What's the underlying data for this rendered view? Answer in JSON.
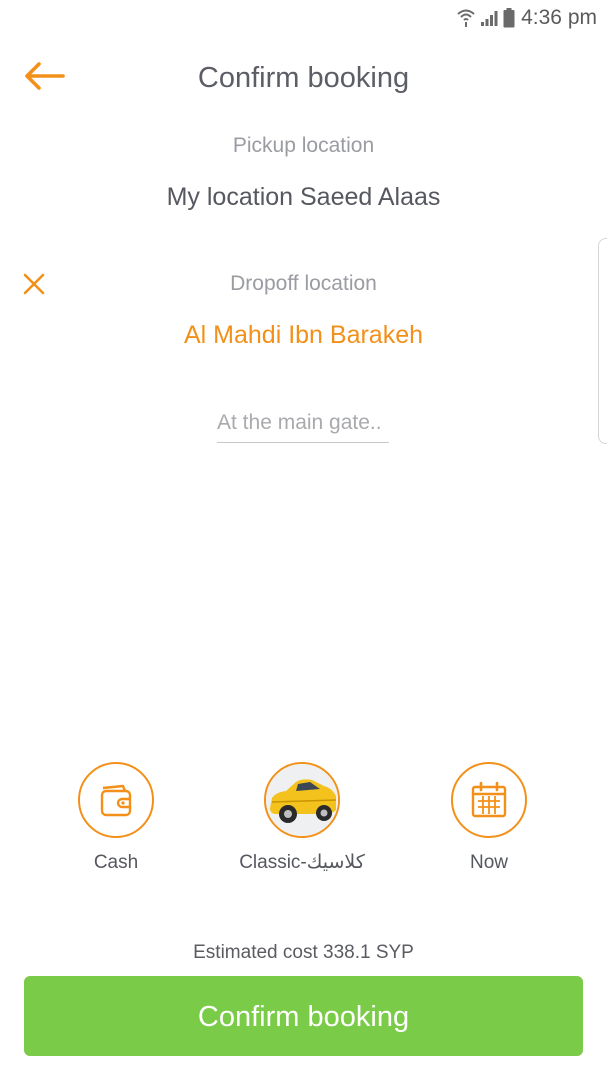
{
  "status_bar": {
    "time": "4:36 pm",
    "icons": [
      "wifi-icon",
      "signal-icon",
      "battery-icon"
    ]
  },
  "header": {
    "back_icon": "arrow-left-icon",
    "title": "Confirm booking"
  },
  "pickup": {
    "caption": "Pickup location",
    "value": "My location Saeed Alaas"
  },
  "dropoff": {
    "clear_icon": "close-icon",
    "caption": "Dropoff location",
    "value": "Al Mahdi Ibn Barakeh"
  },
  "note": {
    "placeholder": "At the main gate..",
    "value": ""
  },
  "options": {
    "payment": {
      "label": "Cash",
      "icon": "wallet-icon"
    },
    "car_type": {
      "label": "Classic-كلاسيك",
      "icon": "taxi-car-icon"
    },
    "time": {
      "label": "Now",
      "icon": "calendar-icon"
    }
  },
  "estimate": {
    "text": "Estimated cost 338.1 SYP"
  },
  "confirm_button": {
    "label": "Confirm booking"
  },
  "colors": {
    "accent": "#f39019",
    "confirm": "#7acc48",
    "text": "#5c5e66",
    "muted": "#9a9ca2"
  }
}
